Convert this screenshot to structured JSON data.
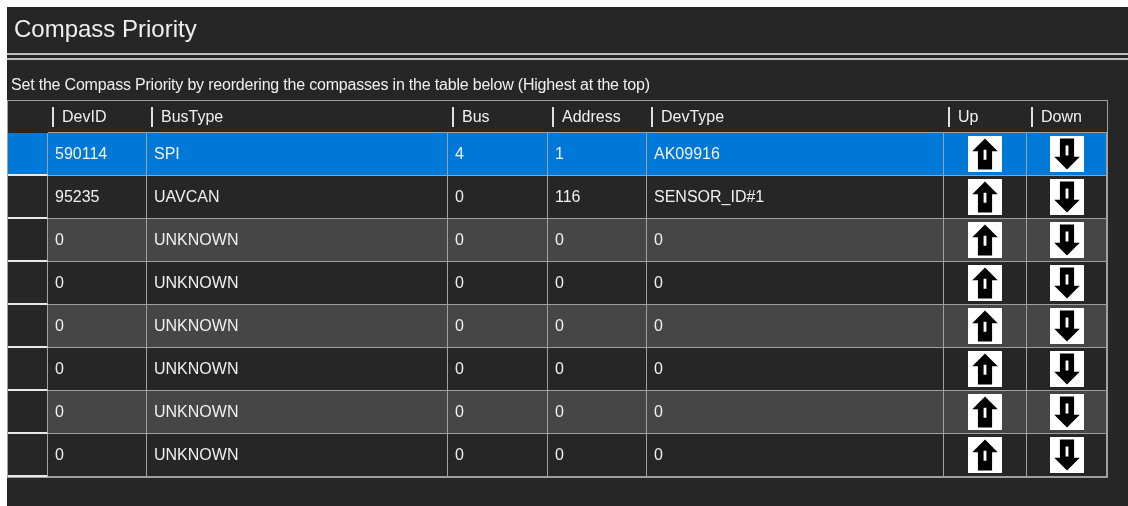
{
  "panel": {
    "title": "Compass Priority",
    "description": "Set the Compass Priority by reordering the compasses in the table below (Highest at the top)"
  },
  "table": {
    "columns": [
      "DevID",
      "BusType",
      "Bus",
      "Address",
      "DevType",
      "Up",
      "Down"
    ],
    "rows": [
      {
        "selected": true,
        "cells": [
          "590114",
          "SPI",
          "4",
          "1",
          "AK09916"
        ]
      },
      {
        "selected": false,
        "cells": [
          "95235",
          "UAVCAN",
          "0",
          "116",
          "SENSOR_ID#1"
        ]
      },
      {
        "selected": false,
        "cells": [
          "0",
          "UNKNOWN",
          "0",
          "0",
          "0"
        ]
      },
      {
        "selected": false,
        "cells": [
          "0",
          "UNKNOWN",
          "0",
          "0",
          "0"
        ]
      },
      {
        "selected": false,
        "cells": [
          "0",
          "UNKNOWN",
          "0",
          "0",
          "0"
        ]
      },
      {
        "selected": false,
        "cells": [
          "0",
          "UNKNOWN",
          "0",
          "0",
          "0"
        ]
      },
      {
        "selected": false,
        "cells": [
          "0",
          "UNKNOWN",
          "0",
          "0",
          "0"
        ]
      },
      {
        "selected": false,
        "cells": [
          "0",
          "UNKNOWN",
          "0",
          "0",
          "0"
        ]
      }
    ]
  }
}
